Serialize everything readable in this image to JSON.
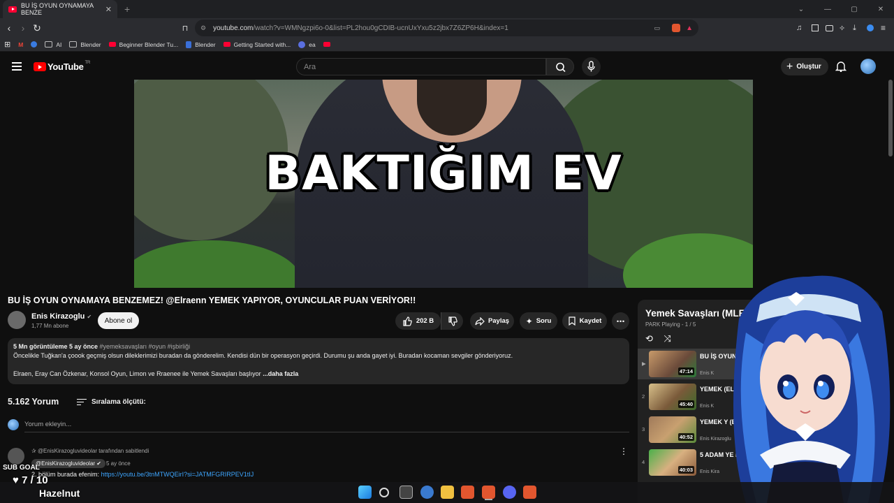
{
  "browser": {
    "tab_title": "BU İŞ OYUN OYNAMAYA BENZE",
    "url_host": "youtube.com",
    "url_rest": "/watch?v=WMNgzpi6o-0&list=PL2hou0gCDIB-ucnUxYxu5z2jbx7Z6ZP6H&index=1",
    "bookmarks": [
      "AI",
      "Blender",
      "Beginner Blender Tu...",
      "Blender",
      "Getting Started with...",
      "ea"
    ]
  },
  "header": {
    "logo_text": "YouTube",
    "logo_region": "TR",
    "search_placeholder": "Ara",
    "create_label": "Oluştur"
  },
  "video": {
    "overlay_text": "BAKTIĞIM EV",
    "title": "BU İŞ OYUN OYNAMAYA BENZEMEZ! @Elraenn YEMEK YAPIYOR, OYUNCULAR PUAN VERİYOR!!",
    "channel": "Enis Kirazoglu",
    "subscribers": "1,77 Mn abone",
    "subscribe_label": "Abone ol",
    "likes": "202 B",
    "share_label": "Paylaş",
    "ask_label": "Soru",
    "save_label": "Kaydet"
  },
  "description": {
    "stats": "5 Mn görüntüleme  5 ay önce",
    "tags": "#yemeksavaşları #oyun #işbirliği",
    "line1": "Öncelikle Tuğkan'a çoook geçmiş olsun dileklerimizi buradan da gönderelim. Kendisi dün bir operasyon geçirdi. Durumu şu anda gayet iyi. Buradan kocaman sevgiler gönderiyoruz.",
    "line2": "Elraen, Eray Can Özkenar, Konsol Oyun, Limon ve Rraenee ile Yemek Savaşları başlıyor",
    "more": "...daha fazla"
  },
  "comments": {
    "count": "5.162 Yorum",
    "sort_label": "Sıralama ölçütü:",
    "add_placeholder": "Yorum ekleyin...",
    "pinned_by": "@EnisKirazogluvideolar tarafından sabitlendi",
    "first_author": "@EnisKirazogluvideolar",
    "first_time": "5 ay önce",
    "first_text": "2. bölüm burada efenim: ",
    "first_link": "https://youtu.be/3tnMTWQEirI?si=JATMFGRIRPEV1tIJ"
  },
  "playlist": {
    "title": "Yemek Savaşları (MLE",
    "subtitle": "PARK Playing - 1 / 5",
    "items": [
      {
        "num": "▶",
        "title": "BU İŞ OYUN YEMEK",
        "channel": "Enis K",
        "duration": "47:14"
      },
      {
        "num": "2",
        "title": "YEMEK (ELRA",
        "channel": "Enis K",
        "duration": "45:40"
      },
      {
        "num": "3",
        "title": "YEMEK Y (ELRAEN",
        "channel": "Enis Kirazoglu",
        "duration": "40:52"
      },
      {
        "num": "4",
        "title": "5 ADAM YE ELRAEN,",
        "channel": "Enis Kira",
        "duration": "40:03"
      }
    ]
  },
  "stream_overlay": {
    "sub_goal": "SUB GOAL",
    "goal_value": "♥ 7 / 10",
    "name": "Hazelnut"
  }
}
